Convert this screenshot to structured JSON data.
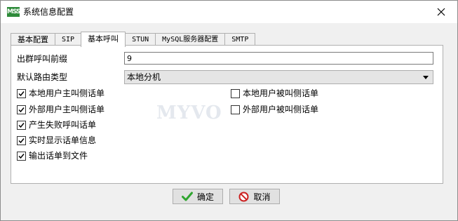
{
  "window": {
    "title": "系统信息配置",
    "icon": "app-logo-icon"
  },
  "tabs": [
    {
      "label": "基本配置"
    },
    {
      "label": "SIP"
    },
    {
      "label": "基本呼叫"
    },
    {
      "label": "STUN"
    },
    {
      "label": "MySQL服务器配置"
    },
    {
      "label": "SMTP"
    }
  ],
  "active_tab": "基本呼叫",
  "form": {
    "prefix_label": "出群呼叫前缀",
    "prefix_value": "9",
    "route_label": "默认路由类型",
    "route_value": "本地分机"
  },
  "checkboxes_left": [
    {
      "label": "本地用户主叫侧话单",
      "checked": true
    },
    {
      "label": "外部用户主叫侧话单",
      "checked": true
    },
    {
      "label": "产生失败呼叫话单",
      "checked": true
    },
    {
      "label": "实时显示话单信息",
      "checked": true
    },
    {
      "label": "输出话单到文件",
      "checked": true
    }
  ],
  "checkboxes_right": [
    {
      "label": "本地用户被叫侧话单",
      "checked": false
    },
    {
      "label": "外部用户被叫侧话单",
      "checked": false
    }
  ],
  "watermark": "MYVO",
  "buttons": {
    "ok": "确定",
    "cancel": "取消"
  },
  "colors": {
    "ok_icon": "#2fa52f",
    "cancel_icon": "#cc2222",
    "app_icon": "#2e8b3a"
  }
}
